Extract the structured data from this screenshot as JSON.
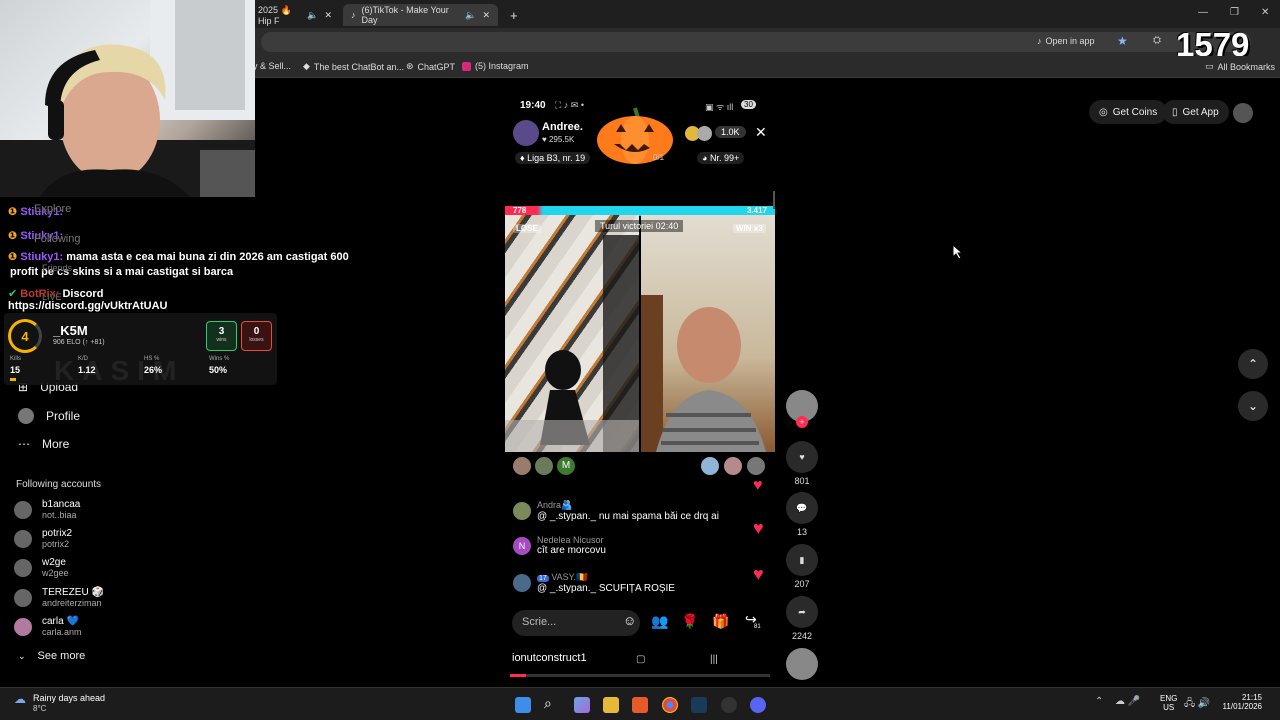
{
  "browser": {
    "tabs": [
      {
        "label": "2025 🔥 Hip F"
      },
      {
        "label": "(6)TikTok - Make Your Day"
      }
    ],
    "new_tab": "+",
    "open_in_app": "Open in app",
    "bookmarks": [
      "y & Sell...",
      "The best ChatBot an...",
      "ChatGPT",
      "(5) Instagram"
    ],
    "all_bookmarks": "All Bookmarks",
    "overlay_count": "1579"
  },
  "chat": [
    {
      "user": "Stiuky1:",
      "text": ""
    },
    {
      "user": "Stiuky1:",
      "text": ""
    },
    {
      "user": "Stiuky1:",
      "text": "mama asta e cea mai buna zi din 2026 am castigat 600"
    },
    {
      "user": "",
      "text": "profit pe cs skins si a mai castigat si barca"
    },
    {
      "user": "BotRix:",
      "text": "Discord https://discord.gg/vUktrAtUAU"
    }
  ],
  "nav": {
    "explore": "Explore",
    "following": "Following",
    "friends": "Friends",
    "live": "LIVE",
    "upload": "Upload",
    "profile": "Profile",
    "more": "More"
  },
  "faceit": {
    "level": "4",
    "name": "_K5M",
    "elo": "906 ELO (↑ +81)",
    "wins": "3",
    "wins_label": "wins",
    "losses": "0",
    "losses_label": "losses",
    "stats": [
      {
        "label": "Kills",
        "value": "15"
      },
      {
        "label": "K/D",
        "value": "1.12"
      },
      {
        "label": "HS %",
        "value": "26%"
      },
      {
        "label": "Wins %",
        "value": "50%"
      }
    ],
    "watermark": "KASIM"
  },
  "following_accounts": {
    "title": "Following accounts",
    "items": [
      {
        "name": "b1ancaa",
        "handle": "not..biaa"
      },
      {
        "name": "potrix2",
        "handle": "potrix2"
      },
      {
        "name": "w2ge",
        "handle": "w2gee"
      },
      {
        "name": "TEREZEU 🎲",
        "handle": "andreiterziman"
      },
      {
        "name": "carla 💙",
        "handle": "carla.anm"
      }
    ],
    "see_more": "See more"
  },
  "phone": {
    "time": "19:40",
    "battery": "30",
    "host": "Andree.",
    "likes": "295.5K",
    "viewers": "1.0K",
    "league": "Liga B3, nr. 19",
    "rank": "Nr. 99+",
    "goal": "0/1",
    "left_score": "778",
    "right_score": "3.417",
    "round": "Turul victoriei 02:40",
    "lose": "LOSE",
    "win": "WIN x3",
    "badge_m": "M",
    "comments": [
      {
        "user": "Andra🫂",
        "text": "@ _.stypan._ nu mai spama băi ce drq ai"
      },
      {
        "user": "Nedelea Nicusor",
        "text": "cît are morcovu"
      },
      {
        "user": "VASY.🇷🇴",
        "text": "@ _.stypan._ SCUFIȚA ROȘIE",
        "level": "17"
      }
    ],
    "input_placeholder": "Scrie...",
    "share_count": "81",
    "bottom_user": "ionutconstruct1"
  },
  "side_actions": {
    "likes": "801",
    "comments": "13",
    "saves": "207",
    "shares": "2242"
  },
  "top_right": {
    "get_coins": "Get Coins",
    "get_app": "Get App"
  },
  "taskbar": {
    "weather_title": "Rainy days ahead",
    "weather_temp": "8°C",
    "lang1": "ENG",
    "lang2": "US",
    "time": "21:15",
    "date": "11/01/2026"
  },
  "colors": {
    "accent_red": "#fe2c55",
    "teal": "#20d5ec",
    "tiktok_bg": "#000000"
  }
}
